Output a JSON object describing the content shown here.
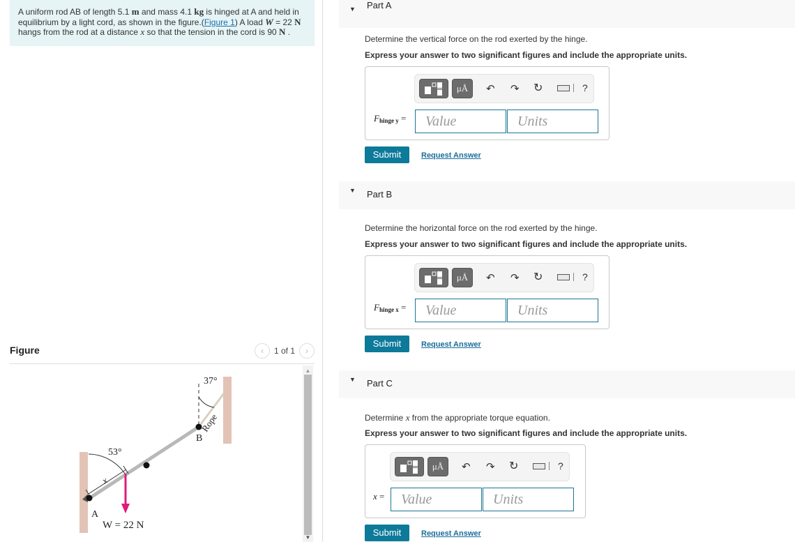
{
  "problem": {
    "text_1": "A uniform rod AB of length 5.1 ",
    "length_unit": "m",
    "text_2": " and mass 4.1 ",
    "mass_unit": "kg",
    "text_3": " is hinged at A and held in equilibrium by a light cord, as shown in the figure.(",
    "figure_link": "Figure 1",
    "text_4": ") A load ",
    "load_symbol": "W",
    "text_5": " = 22 ",
    "load_unit": "N",
    "text_6": " hangs from the rod at a distance ",
    "distance_symbol": "x",
    "text_7": " so that the tension in the cord is 90 ",
    "tension_unit": "N",
    "text_8": " ."
  },
  "figure": {
    "title": "Figure",
    "page_indicator": "1 of 1",
    "prev_icon": "chevron-left-icon",
    "next_icon": "chevron-right-icon",
    "labels": {
      "angle_top": "37°",
      "angle_bottom": "53°",
      "rope": "Rope",
      "point_a": "A",
      "point_b": "B",
      "distance": "x",
      "load": "W = 22 N"
    },
    "colors": {
      "wall": "#e2c3b5",
      "rod": "#b8b8b8",
      "load_arrow": "#e0197d",
      "rope": "#d8d0c0"
    }
  },
  "parts": [
    {
      "title": "Part A",
      "description": "Determine the vertical force on the rod exerted by the hinge.",
      "instruction": "Express your answer to two significant figures and include the appropriate units.",
      "var_symbol": "F",
      "var_subscript": "hinge y",
      "var_eq": " =",
      "value_placeholder": "Value",
      "units_placeholder": "Units",
      "submit_label": "Submit",
      "request_label": "Request Answer"
    },
    {
      "title": "Part B",
      "description": "Determine the horizontal force on the rod exerted by the hinge.",
      "instruction": "Express your answer to two significant figures and include the appropriate units.",
      "var_symbol": "F",
      "var_subscript": "hinge x",
      "var_eq": " =",
      "value_placeholder": "Value",
      "units_placeholder": "Units",
      "submit_label": "Submit",
      "request_label": "Request Answer"
    },
    {
      "title": "Part C",
      "description_1": "Determine ",
      "description_symbol": "x",
      "description_2": " from the appropriate torque equation.",
      "instruction": "Express your answer to two significant figures and include the appropriate units.",
      "var_symbol": "x",
      "var_eq": " =",
      "value_placeholder": "Value",
      "units_placeholder": "Units",
      "submit_label": "Submit",
      "request_label": "Request Answer"
    }
  ],
  "toolbar": {
    "units_label": "μÅ",
    "help_label": "?",
    "undo_icon": "↶",
    "redo_icon": "↷",
    "reset_icon": "↻"
  },
  "colors": {
    "problem_bg": "#e6f4f6",
    "submit_bg": "#0d7a9a",
    "link": "#1b6d99",
    "input_border": "#1b7593"
  }
}
